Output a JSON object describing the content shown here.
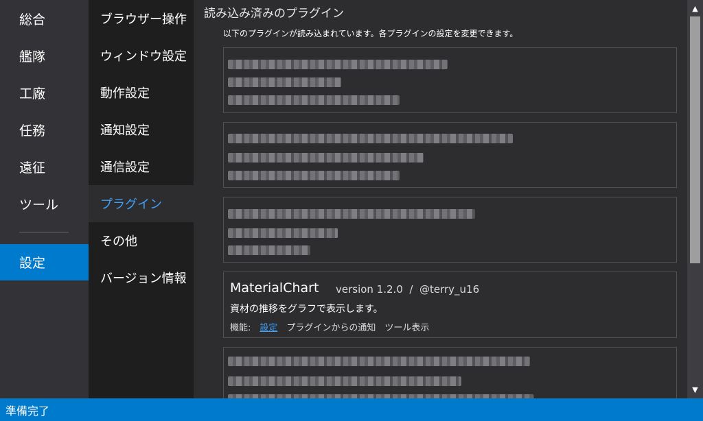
{
  "main_nav": {
    "items": [
      {
        "label": "総合"
      },
      {
        "label": "艦隊"
      },
      {
        "label": "工廠"
      },
      {
        "label": "任務"
      },
      {
        "label": "遠征"
      },
      {
        "label": "ツール"
      }
    ],
    "settings_label": "設定"
  },
  "sub_nav": {
    "items": [
      {
        "label": "ブラウザー操作"
      },
      {
        "label": "ウィンドウ設定"
      },
      {
        "label": "動作設定"
      },
      {
        "label": "通知設定"
      },
      {
        "label": "通信設定"
      },
      {
        "label": "プラグイン"
      },
      {
        "label": "その他"
      },
      {
        "label": "バージョン情報"
      }
    ],
    "active": "プラグイン"
  },
  "content": {
    "title": "読み込み済みのプラグイン",
    "subtitle": "以下のプラグインが読み込まれています。各プラグインの設定を変更できます。",
    "plugin": {
      "name": "MaterialChart",
      "version": "version 1.2.0  /  @terry_u16",
      "description": "資材の推移をグラフで表示します。",
      "features_label": "機能:",
      "feature_link": "設定",
      "feature_notify": "プラグインからの通知",
      "feature_tool": "ツール表示"
    }
  },
  "status_bar": {
    "text": "準備完了"
  },
  "colors": {
    "accent": "#007acc",
    "link": "#3fa0f5"
  }
}
